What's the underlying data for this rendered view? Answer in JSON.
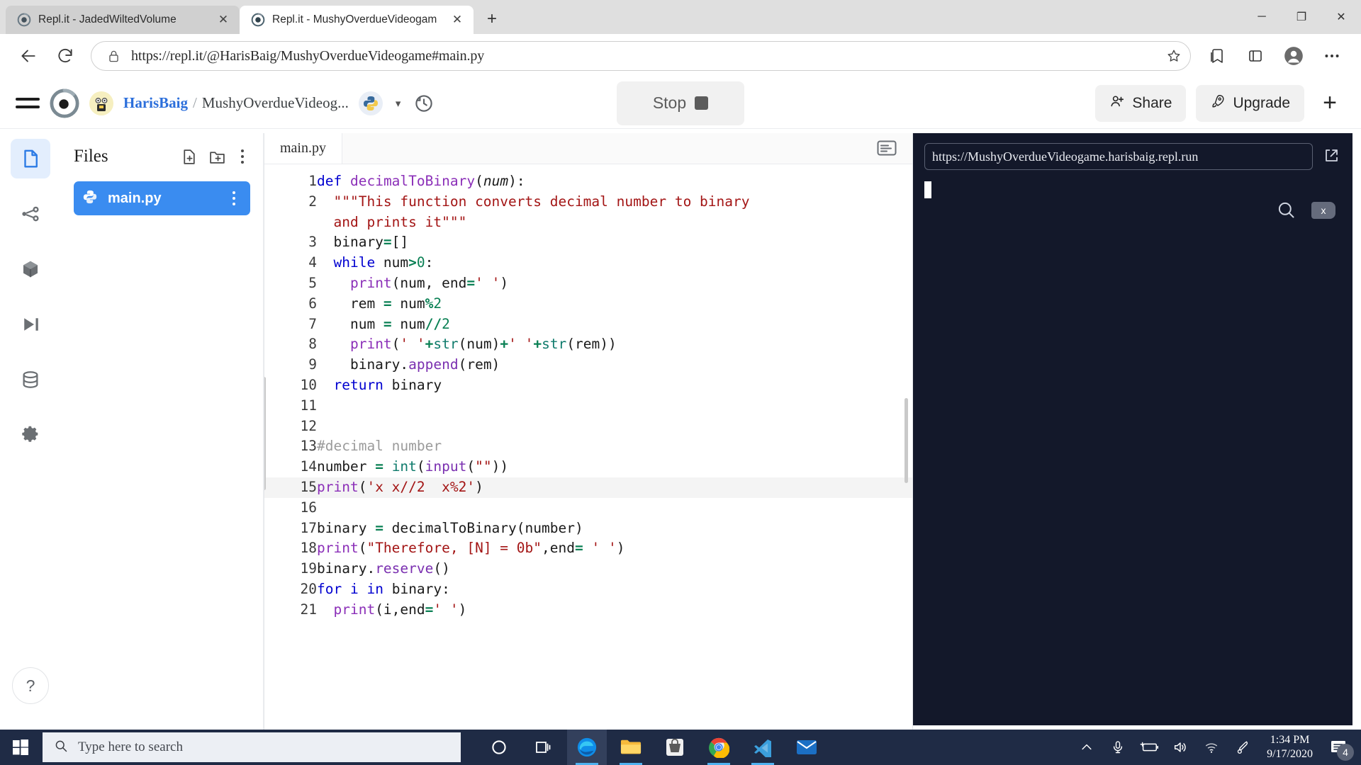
{
  "browser": {
    "tabs": [
      {
        "title": "Repl.it - JadedWiltedVolume",
        "favicon": "replit-icon",
        "active": false
      },
      {
        "title": "Repl.it - MushyOverdueVideogam",
        "favicon": "replit-icon",
        "active": true
      }
    ],
    "new_tab_label": "+",
    "window_controls": {
      "minimize": "─",
      "maximize": "❐",
      "close": "✕"
    },
    "nav": {
      "back": "←",
      "reload": "↻"
    },
    "url": "https://repl.it/@HarisBaig/MushyOverdueVideogame#main.py",
    "lock_icon": "lock-icon",
    "favorite_icon": "star-icon",
    "collections_icon": "collections-icon",
    "addons_icon": "extensions-icon",
    "profile_icon": "profile-icon",
    "settings_icon": "more-icon"
  },
  "replit": {
    "menu_icon": "hamburger-icon",
    "logo": "replit-logo",
    "avatar": "user-avatar",
    "breadcrumb": {
      "user": "HarisBaig",
      "separator": "/",
      "project": "MushyOverdueVideog..."
    },
    "language_badge": "python-icon",
    "chevron": "▾",
    "history_icon": "history-icon",
    "run_button": {
      "label": "Stop",
      "state": "running"
    },
    "share_button": "Share",
    "upgrade_button": "Upgrade",
    "add_button": "+"
  },
  "rail": {
    "items": [
      {
        "name": "files-icon",
        "active": true
      },
      {
        "name": "version-control-icon",
        "active": false
      },
      {
        "name": "packages-icon",
        "active": false
      },
      {
        "name": "debugger-icon",
        "active": false
      },
      {
        "name": "database-icon",
        "active": false
      },
      {
        "name": "settings-icon",
        "active": false
      }
    ],
    "help_label": "?"
  },
  "files": {
    "title": "Files",
    "new_file_icon": "new-file-icon",
    "new_folder_icon": "new-folder-icon",
    "more_icon": "more-vertical-icon",
    "entries": [
      {
        "name": "main.py",
        "icon": "python-icon",
        "selected": true
      }
    ]
  },
  "editor": {
    "tabs": [
      {
        "label": "main.py",
        "active": true
      }
    ],
    "menu_icon": "editor-menu-icon",
    "highlighted_line": 15,
    "lines": [
      {
        "n": "1",
        "html": "<span class=\"k\">def</span> <span class=\"fn\">decimalToBinary</span>(<span class=\"pa\">num</span>):"
      },
      {
        "n": "2",
        "html": "  <span class=\"st\">\"\"\"This function converts decimal number to binary</span>"
      },
      {
        "n": "",
        "html": "  <span class=\"st\">and prints it\"\"\"</span>"
      },
      {
        "n": "3",
        "html": "  binary<span class=\"op\">=</span>[]"
      },
      {
        "n": "4",
        "html": "  <span class=\"k\">while</span> num<span class=\"op\">&gt;</span><span class=\"nu\">0</span>:"
      },
      {
        "n": "5",
        "html": "    <span class=\"fn\">print</span>(num, end<span class=\"op\">=</span><span class=\"st\">' '</span>)"
      },
      {
        "n": "6",
        "html": "    rem <span class=\"op\">=</span> num<span class=\"op\">%</span><span class=\"nu\">2</span>"
      },
      {
        "n": "7",
        "html": "    num <span class=\"op\">=</span> num<span class=\"op\">//</span><span class=\"nu\">2</span>"
      },
      {
        "n": "8",
        "html": "    <span class=\"fn\">print</span>(<span class=\"st\">' '</span><span class=\"op\">+</span><span class=\"bi\">str</span>(num)<span class=\"op\">+</span><span class=\"st\">' '</span><span class=\"op\">+</span><span class=\"bi\">str</span>(rem))"
      },
      {
        "n": "9",
        "html": "    binary.<span class=\"at\">append</span>(rem)"
      },
      {
        "n": "10",
        "html": "  <span class=\"k\">return</span> binary"
      },
      {
        "n": "11",
        "html": ""
      },
      {
        "n": "12",
        "html": ""
      },
      {
        "n": "13",
        "html": "<span class=\"cm\">#decimal number</span>"
      },
      {
        "n": "14",
        "html": "number <span class=\"op\">=</span> <span class=\"bi\">int</span>(<span class=\"at\">input</span>(<span class=\"st\">\"\"</span>))"
      },
      {
        "n": "15",
        "html": "<span class=\"fn\">print</span>(<span class=\"st\">'x x//2  x%2'</span>)"
      },
      {
        "n": "16",
        "html": ""
      },
      {
        "n": "17",
        "html": "binary <span class=\"op\">=</span> decimalToBinary(number)"
      },
      {
        "n": "18",
        "html": "<span class=\"fn\">print</span>(<span class=\"st\">\"Therefore, [N] = 0b\"</span>,end<span class=\"op\">=</span> <span class=\"st\">' '</span>)"
      },
      {
        "n": "19",
        "html": "binary.<span class=\"at\">reserve</span>()"
      },
      {
        "n": "20",
        "html": "<span class=\"k\">for</span> <span class=\"k\">i</span> <span class=\"k\">in</span> binary:"
      },
      {
        "n": "21",
        "html": "  <span class=\"fn\">print</span>(i,end<span class=\"op\">=</span><span class=\"st\">' '</span>)"
      }
    ]
  },
  "console": {
    "url": "https://MushyOverdueVideogame.harisbaig.repl.run",
    "open_external_icon": "external-link-icon",
    "search_icon": "search-icon",
    "clear_icon": "clear-console-icon",
    "output": ""
  },
  "taskbar": {
    "start_icon": "windows-start-icon",
    "search_placeholder": "Type here to search",
    "search_icon": "search-icon",
    "cortana_icon": "cortana-icon",
    "taskview_icon": "task-view-icon",
    "apps": [
      {
        "name": "microsoft-edge-icon",
        "running": true,
        "active": true
      },
      {
        "name": "file-explorer-icon",
        "running": true,
        "active": false
      },
      {
        "name": "microsoft-store-icon",
        "running": false,
        "active": false
      },
      {
        "name": "google-chrome-icon",
        "running": true,
        "active": false
      },
      {
        "name": "vs-code-icon",
        "running": true,
        "active": false
      },
      {
        "name": "mail-icon",
        "running": false,
        "active": false
      }
    ],
    "tray": {
      "show_hidden_icon": "chevron-up-icon",
      "microphone_icon": "microphone-icon",
      "battery_icon": "battery-charging-icon",
      "volume_icon": "volume-icon",
      "wifi_icon": "wifi-icon",
      "pen_icon": "pen-icon",
      "time": "1:34 PM",
      "date": "9/17/2020",
      "notification_icon": "notifications-icon",
      "notification_count": "4"
    }
  },
  "colors": {
    "accent_blue": "#3a8cf0",
    "link_blue": "#2c6fdb",
    "console_bg": "#13182a",
    "taskbar_bg": "#1f2b45"
  }
}
